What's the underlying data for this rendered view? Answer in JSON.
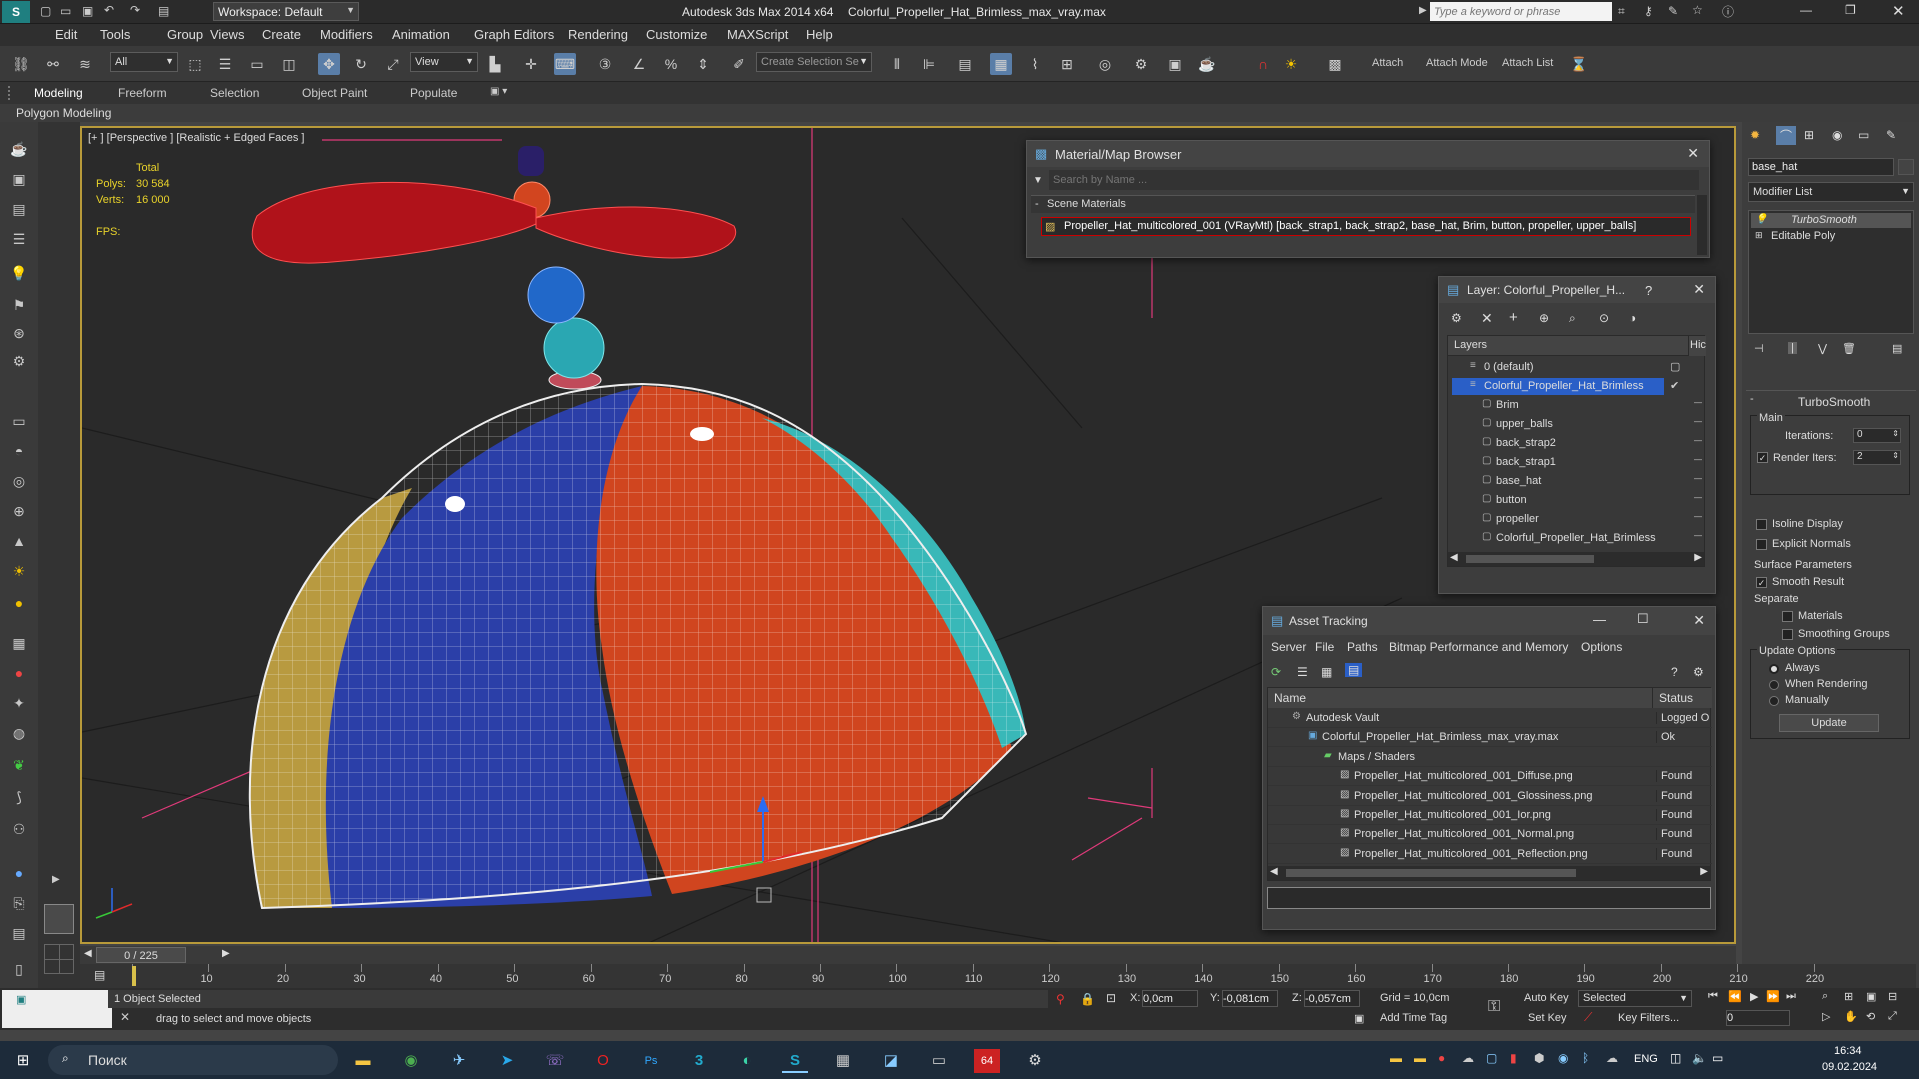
{
  "title_bar": {
    "workspace": "Workspace: Default",
    "app_title": "Autodesk 3ds Max  2014 x64",
    "file_title": "Colorful_Propeller_Hat_Brimless_max_vray.max",
    "search_placeholder": "Type a keyword or phrase"
  },
  "menu": [
    "Edit",
    "Tools",
    "Group",
    "Views",
    "Create",
    "Modifiers",
    "Animation",
    "Graph Editors",
    "Rendering",
    "Customize",
    "MAXScript",
    "Help"
  ],
  "toolbar": {
    "selection_filter": "All",
    "ref_coord": "View",
    "selection_set_placeholder": "Create Selection Se",
    "attach": "Attach",
    "attach_mode": "Attach Mode",
    "attach_list": "Attach List"
  },
  "ribbon": {
    "tabs": [
      "Modeling",
      "Freeform",
      "Selection",
      "Object Paint",
      "Populate"
    ],
    "sub": "Polygon Modeling"
  },
  "viewport": {
    "label": "[+ ] [Perspective ] [Realistic + Edged Faces ]",
    "stats_total": "Total",
    "polys_label": "Polys:",
    "polys_value": "30 584",
    "verts_label": "Verts:",
    "verts_value": "16 000",
    "fps_label": "FPS:"
  },
  "material_browser": {
    "title": "Material/Map Browser",
    "search_placeholder": "Search by Name ...",
    "section": "Scene Materials",
    "material": "Propeller_Hat_multicolored_001  (VRayMtl) [back_strap1, back_strap2, base_hat, Brim, button, propeller, upper_balls]"
  },
  "layer_dialog": {
    "title": "Layer: Colorful_Propeller_H...",
    "help": "?",
    "column": "Layers",
    "column_hide": "Hic",
    "items": [
      {
        "name": "0 (default)",
        "level": 0
      },
      {
        "name": "Colorful_Propeller_Hat_Brimless",
        "level": 0,
        "selected": true
      },
      {
        "name": "Brim",
        "level": 1
      },
      {
        "name": "upper_balls",
        "level": 1
      },
      {
        "name": "back_strap2",
        "level": 1
      },
      {
        "name": "back_strap1",
        "level": 1
      },
      {
        "name": "base_hat",
        "level": 1
      },
      {
        "name": "button",
        "level": 1
      },
      {
        "name": "propeller",
        "level": 1
      },
      {
        "name": "Colorful_Propeller_Hat_Brimless",
        "level": 1
      }
    ]
  },
  "asset_tracking": {
    "title": "Asset Tracking",
    "menu": [
      "Server",
      "File",
      "Paths",
      "Bitmap Performance and Memory",
      "Options"
    ],
    "col_name": "Name",
    "col_status": "Status",
    "rows": [
      {
        "name": "Autodesk Vault",
        "status": "Logged Ou",
        "level": 0
      },
      {
        "name": "Colorful_Propeller_Hat_Brimless_max_vray.max",
        "status": "Ok",
        "level": 1
      },
      {
        "name": "Maps / Shaders",
        "status": "",
        "level": 2
      },
      {
        "name": "Propeller_Hat_multicolored_001_Diffuse.png",
        "status": "Found",
        "level": 3
      },
      {
        "name": "Propeller_Hat_multicolored_001_Glossiness.png",
        "status": "Found",
        "level": 3
      },
      {
        "name": "Propeller_Hat_multicolored_001_Ior.png",
        "status": "Found",
        "level": 3
      },
      {
        "name": "Propeller_Hat_multicolored_001_Normal.png",
        "status": "Found",
        "level": 3
      },
      {
        "name": "Propeller_Hat_multicolored_001_Reflection.png",
        "status": "Found",
        "level": 3
      }
    ]
  },
  "command_panel": {
    "object_name": "base_hat",
    "modifier_list": "Modifier List",
    "stack": [
      "TurboSmooth",
      "Editable Poly"
    ],
    "rollout_title": "TurboSmooth",
    "main_label": "Main",
    "iterations_label": "Iterations:",
    "iterations_value": "0",
    "render_iters_label": "Render Iters:",
    "render_iters_value": "2",
    "isoline": "Isoline Display",
    "explicit_normals": "Explicit Normals",
    "surface_params": "Surface Parameters",
    "smooth_result": "Smooth Result",
    "separate": "Separate",
    "materials": "Materials",
    "smoothing_groups": "Smoothing Groups",
    "update_options": "Update Options",
    "always": "Always",
    "when_rendering": "When Rendering",
    "manually": "Manually",
    "update_button": "Update"
  },
  "timeline": {
    "frame": "0 / 225",
    "ticks": [
      "0",
      "10",
      "20",
      "30",
      "40",
      "50",
      "60",
      "70",
      "80",
      "90",
      "100",
      "110",
      "120",
      "130",
      "140",
      "150",
      "160",
      "170",
      "180",
      "190",
      "200",
      "210",
      "220"
    ]
  },
  "status": {
    "selected": "1 Object Selected",
    "prompt": "drag to select and move objects",
    "x_label": "X:",
    "x": "0,0cm",
    "y_label": "Y:",
    "y": "-0,081cm",
    "z_label": "Z:",
    "z": "-0,057cm",
    "grid": "Grid = 10,0cm",
    "add_time_tag": "Add Time Tag",
    "auto_key": "Auto Key",
    "set_key": "Set Key",
    "key_mode": "Selected",
    "key_filters": "Key Filters...",
    "frame_value": "0"
  },
  "taskbar": {
    "search": "Поиск",
    "lang": "ENG",
    "time": "16:34",
    "date": "09.02.2024"
  },
  "colors": {
    "hat_red": "#d0451f",
    "hat_blue": "#2b3fa8",
    "hat_cyan": "#39b8b8",
    "propeller_red": "#b0121a",
    "selection_blue": "#2a5fc7",
    "viewport_border": "#b89a3a"
  }
}
